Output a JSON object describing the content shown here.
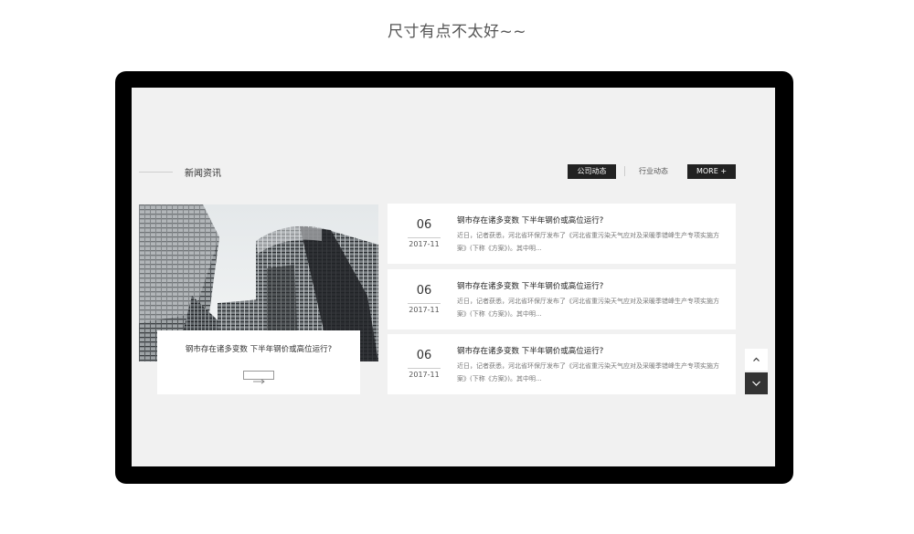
{
  "caption": "尺寸有点不太好~~",
  "section": {
    "title": "新闻资讯",
    "tabs": [
      {
        "label": "公司动态",
        "active": true
      },
      {
        "label": "行业动态",
        "active": false
      }
    ],
    "more_label": "MORE +"
  },
  "feature": {
    "title": "钢市存在诸多变数 下半年钢价或高位运行?",
    "image_icon": "office-building-photo",
    "arrow_icon": "arrow-right-icon"
  },
  "news": [
    {
      "day": "06",
      "year_month": "2017-11",
      "title": "钢市存在诸多变数 下半年钢价或高位运行?",
      "summary": "近日，记者获悉，河北省环保厅发布了《河北省重污染天气应对及采暖季错峰生产专项实施方案》(下称《方案》)。其中明..."
    },
    {
      "day": "06",
      "year_month": "2017-11",
      "title": "钢市存在诸多变数 下半年钢价或高位运行?",
      "summary": "近日，记者获悉，河北省环保厅发布了《河北省重污染天气应对及采暖季错峰生产专项实施方案》(下称《方案》)。其中明..."
    },
    {
      "day": "06",
      "year_month": "2017-11",
      "title": "钢市存在诸多变数 下半年钢价或高位运行?",
      "summary": "近日，记者获悉，河北省环保厅发布了《河北省重污染天气应对及采暖季错峰生产专项实施方案》(下称《方案》)。其中明..."
    }
  ],
  "nav": {
    "up_icon": "chevron-up-icon",
    "down_icon": "chevron-down-icon"
  },
  "colors": {
    "screen_bg": "#f1f1f1",
    "dark": "#222222",
    "frame": "#000000"
  }
}
